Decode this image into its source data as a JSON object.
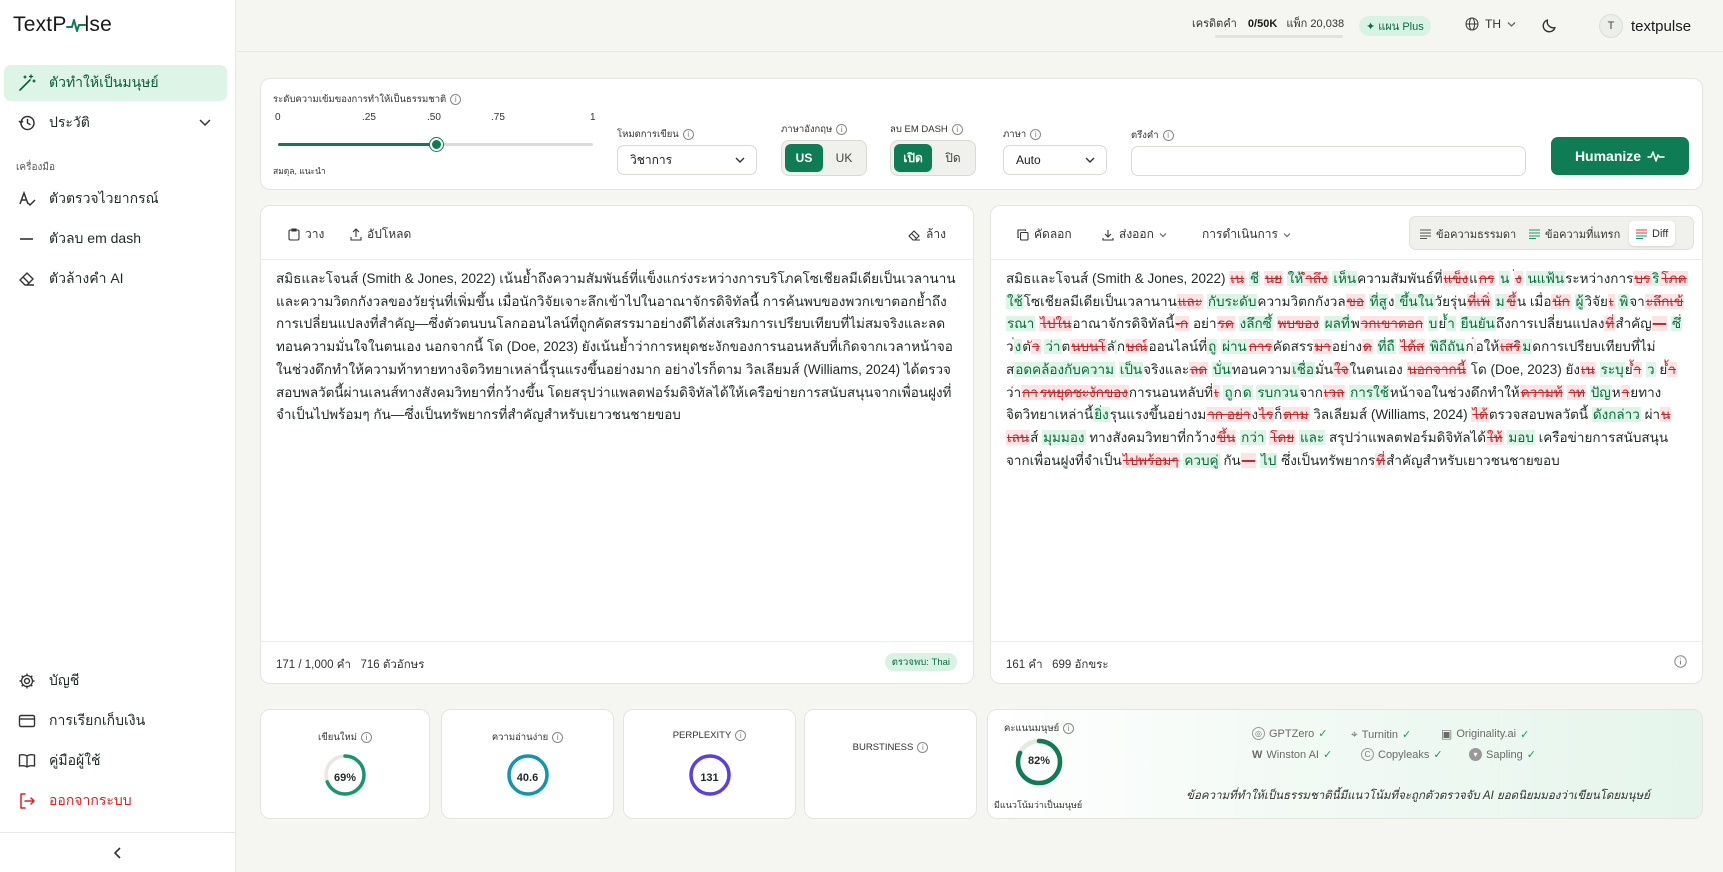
{
  "app": {
    "logo_left": "TextP",
    "logo_right": "lse"
  },
  "sidebar": {
    "items": [
      {
        "label": "ตัวทำให้เป็นมนุษย์",
        "icon": "magic-wand-icon"
      },
      {
        "label": "ประวัติ",
        "icon": "history-icon"
      }
    ],
    "section_label": "เครื่องมือ",
    "tools": [
      {
        "label": "ตัวตรวจไวยากรณ์",
        "icon": "grammar-icon"
      },
      {
        "label": "ตัวลบ em dash",
        "icon": "dash-icon"
      },
      {
        "label": "ตัวล้างคำ AI",
        "icon": "eraser-icon"
      }
    ],
    "bottom": [
      {
        "label": "บัญชี",
        "icon": "gear-icon"
      },
      {
        "label": "การเรียกเก็บเงิน",
        "icon": "credit-card-icon"
      },
      {
        "label": "คู่มือผู้ใช้",
        "icon": "book-icon"
      },
      {
        "label": "ออกจากระบบ",
        "icon": "logout-icon"
      }
    ],
    "collapse_icon": "chevron-left-icon"
  },
  "topbar": {
    "credits_label": "เครดิตคำ",
    "credits_value": "0/50K",
    "pack_label": "แพ็ก",
    "pack_value": "20,038",
    "credits_used_fraction": 0,
    "plan": "แผน Plus",
    "language": "TH",
    "username": "textpulse",
    "avatar_letter": "T"
  },
  "settings": {
    "intensity_label": "ระดับความเข้มของการทำให้เป็นธรรมชาติ",
    "ticks": [
      "0",
      ".25",
      ".50",
      ".75",
      "1"
    ],
    "intensity_value": 0.5,
    "intensity_hint": "สมดุล, แนะนำ",
    "mode_label": "โหมดการเขียน",
    "mode_value": "วิชาการ",
    "english_label": "ภาษาอังกฤษ",
    "english_options": [
      "US",
      "UK"
    ],
    "english_selected": "US",
    "emdash_label": "ลบ EM DASH",
    "emdash_options": [
      "เปิด",
      "ปิด"
    ],
    "emdash_selected": "เปิด",
    "language_label": "ภาษา",
    "language_value": "Auto",
    "keywords_label": "ตรึงคำ",
    "keywords_value": "",
    "humanize_button": "Humanize"
  },
  "input_panel": {
    "paste": "วาง",
    "upload": "อัปโหลด",
    "clear": "ล้าง",
    "text": "สมิธและโจนส์ (Smith & Jones, 2022) เน้นย้ำถึงความสัมพันธ์ที่แข็งแกร่งระหว่างการบริโภคโซเชียลมีเดียเป็นเวลานานและความวิตกกังวลของวัยรุ่นที่เพิ่มขึ้น เมื่อนักวิจัยเจาะลึกเข้าไปในอาณาจักรดิจิทัลนี้ การค้นพบของพวกเขาตอกย้ำถึงการเปลี่ยนแปลงที่สำคัญ—ซึ่งตัวตนบนโลกออนไลน์ที่ถูกคัดสรรมาอย่างดีได้ส่งเสริมการเปรียบเทียบที่ไม่สมจริงและลดทอนความมั่นใจในตนเอง นอกจากนี้ โด (Doe, 2023) ยังเน้นย้ำว่าการหยุดชะงักของการนอนหลับที่เกิดจากเวลาหน้าจอในช่วงดึกทำให้ความท้าทายทางจิตวิทยาเหล่านี้รุนแรงขึ้นอย่างมาก อย่างไรก็ตาม วิลเลียมส์ (Williams, 2024) ได้ตรวจสอบพลวัตนี้ผ่านเลนส์ทางสังคมวิทยาที่กว้างขึ้น โดยสรุปว่าแพลตฟอร์มดิจิทัลได้ให้เครือข่ายการสนับสนุนจากเพื่อนฝูงที่จำเป็นไปพร้อมๆ กัน—ซึ่งเป็นทรัพยากรที่สำคัญสำหรับเยาวชนชายขอบ",
    "word_count": "171 / 1,000 คำ",
    "char_count": "716 ตัวอักษร",
    "detected": "ตรวจพบ: Thai"
  },
  "output_panel": {
    "copy": "คัดลอก",
    "export": "ส่งออก",
    "actions": "การดำเนินการ",
    "view_plain": "ข้อความธรรมดา",
    "view_inserted": "ข้อความที่แทรก",
    "view_diff": "Diff",
    "diff": [
      {
        "t": "n",
        "v": "สมิธและโจนส์ (Smith & Jones, 2022) "
      },
      {
        "t": "d",
        "v": "เน"
      },
      {
        "t": "n",
        "v": " "
      },
      {
        "t": "i",
        "v": "ชี"
      },
      {
        "t": "n",
        "v": " "
      },
      {
        "t": "d",
        "v": "นย"
      },
      {
        "t": "n",
        "v": " "
      },
      {
        "t": "i",
        "v": "ให้"
      },
      {
        "t": "d",
        "v": "ำถึง"
      },
      {
        "t": "n",
        "v": " "
      },
      {
        "t": "i",
        "v": "เห็น"
      },
      {
        "t": "n",
        "v": "ความสัมพันธ์ที่"
      },
      {
        "t": "d",
        "v": "แข็ง"
      },
      {
        "t": "n",
        "v": "แ"
      },
      {
        "t": "d",
        "v": "กร"
      },
      {
        "t": "n",
        "v": " "
      },
      {
        "t": "i",
        "v": "น"
      },
      {
        "t": "n",
        "v": " "
      },
      {
        "t": "d",
        "v": "่ง"
      },
      {
        "t": "n",
        "v": " "
      },
      {
        "t": "i",
        "v": "นแฟ้น"
      },
      {
        "t": "n",
        "v": "ระหว่างการ"
      },
      {
        "t": "d",
        "v": "บร"
      },
      {
        "t": "i",
        "v": "ริ"
      },
      {
        "t": "d",
        "v": "โภค"
      },
      {
        "t": "i",
        "v": "ใช้"
      },
      {
        "t": "n",
        "v": "โซเชียลมีเดียเป็นเวลานาน"
      },
      {
        "t": "d",
        "v": "และ"
      },
      {
        "t": "n",
        "v": " "
      },
      {
        "t": "i",
        "v": "กับระดับ"
      },
      {
        "t": "n",
        "v": "ความวิตกกังวล"
      },
      {
        "t": "d",
        "v": "ขอ"
      },
      {
        "t": "n",
        "v": " "
      },
      {
        "t": "i",
        "v": "ที่สู"
      },
      {
        "t": "n",
        "v": "ง"
      },
      {
        "t": "i",
        "v": " ขึ้นใน"
      },
      {
        "t": "n",
        "v": "วัยรุ่น"
      },
      {
        "t": "d",
        "v": "ที่เพิ่"
      },
      {
        "t": "n",
        "v": " "
      },
      {
        "t": "i",
        "v": "ม"
      },
      {
        "t": "d",
        "v": "ขึ้"
      },
      {
        "t": "n",
        "v": "น เมื่อ"
      },
      {
        "t": "d",
        "v": "นัก"
      },
      {
        "t": "n",
        "v": " "
      },
      {
        "t": "i",
        "v": "ผู้"
      },
      {
        "t": "n",
        "v": "วิจัย"
      },
      {
        "t": "d",
        "v": "เ"
      },
      {
        "t": "n",
        "v": " "
      },
      {
        "t": "i",
        "v": "พิ"
      },
      {
        "t": "n",
        "v": "จา"
      },
      {
        "t": "d",
        "v": "ะลึกเข้"
      },
      {
        "t": "n",
        "v": " "
      },
      {
        "t": "i",
        "v": "รณา"
      },
      {
        "t": "n",
        "v": " "
      },
      {
        "t": "d",
        "v": "ไปใน"
      },
      {
        "t": "n",
        "v": "อาณาจักรดิจิทัลนี้"
      },
      {
        "t": "d",
        "v": "-ก"
      },
      {
        "t": "n",
        "v": " อย่า"
      },
      {
        "t": "d",
        "v": "รค"
      },
      {
        "t": "n",
        "v": " "
      },
      {
        "t": "i",
        "v": "งลึกซึ้"
      },
      {
        "t": "n",
        "v": " "
      },
      {
        "t": "d",
        "v": "พบของ"
      },
      {
        "t": "n",
        "v": " "
      },
      {
        "t": "i",
        "v": "ผลที่"
      },
      {
        "t": "n",
        "v": "พ"
      },
      {
        "t": "d",
        "v": "วกเขาตอก"
      },
      {
        "t": "n",
        "v": " "
      },
      {
        "t": "i",
        "v": "บ"
      },
      {
        "t": "n",
        "v": "ย"
      },
      {
        "t": "i",
        "v": "้ำ"
      },
      {
        "t": "n",
        "v": " "
      },
      {
        "t": "i",
        "v": "ยืนยัน"
      },
      {
        "t": "n",
        "v": "ถึงการเปลี่ยนแปลง"
      },
      {
        "t": "d",
        "v": "ที่"
      },
      {
        "t": "n",
        "v": "สำคัญ"
      },
      {
        "t": "d",
        "v": "—"
      },
      {
        "t": "n",
        "v": " "
      },
      {
        "t": "i",
        "v": "ซึ่"
      },
      {
        "t": "n",
        "v": " ว"
      },
      {
        "t": "i",
        "v": "่ง"
      },
      {
        "t": "n",
        "v": "ต"
      },
      {
        "t": "d",
        "v": "ัว"
      },
      {
        "t": "n",
        "v": " "
      },
      {
        "t": "i",
        "v": "ว่า"
      },
      {
        "t": "n",
        "v": "ต"
      },
      {
        "t": "d",
        "v": "นบนโ"
      },
      {
        "t": "n",
        "v": "ล"
      },
      {
        "t": "i",
        "v": "ั"
      },
      {
        "t": "n",
        "v": "ก"
      },
      {
        "t": "d",
        "v": "ษณ์"
      },
      {
        "t": "n",
        "v": "ออนไลน์ที่"
      },
      {
        "t": "i",
        "v": "ถู"
      },
      {
        "t": "n",
        "v": " "
      },
      {
        "t": "i",
        "v": "ผ่าน"
      },
      {
        "t": "d",
        "v": "การ"
      },
      {
        "t": "n",
        "v": "คัดสรร"
      },
      {
        "t": "d",
        "v": "มา"
      },
      {
        "t": "n",
        "v": "อย่าง"
      },
      {
        "t": "d",
        "v": "ด"
      },
      {
        "t": "n",
        "v": " "
      },
      {
        "t": "i",
        "v": "ที่ถื"
      },
      {
        "t": "n",
        "v": " "
      },
      {
        "t": "d",
        "v": "ได้ส"
      },
      {
        "t": "n",
        "v": " "
      },
      {
        "t": "i",
        "v": "พิถีถัน"
      },
      {
        "t": "n",
        "v": "ก"
      },
      {
        "t": "d",
        "v": "่"
      },
      {
        "t": "n",
        "v": "อให้"
      },
      {
        "t": "d",
        "v": "เสร"
      },
      {
        "t": "n",
        "v": "ิ"
      },
      {
        "t": "i",
        "v": "ม"
      },
      {
        "t": "n",
        "v": "ด"
      },
      {
        "t": "n",
        "v": "การเปรียบเทียบที่"
      },
      {
        "t": "n",
        "v": "ไม่ส"
      },
      {
        "t": "i",
        "v": "อดคล้องกับความ"
      },
      {
        "t": "n",
        "v": " "
      },
      {
        "t": "i",
        "v": "เป็น"
      },
      {
        "t": "n",
        "v": "จริงและ"
      },
      {
        "t": "d",
        "v": "ลด"
      },
      {
        "t": "n",
        "v": " "
      },
      {
        "t": "i",
        "v": "บั่น"
      },
      {
        "t": "n",
        "v": "ทอนความ"
      },
      {
        "t": "i",
        "v": "เชื่อ"
      },
      {
        "t": "n",
        "v": "มั่น"
      },
      {
        "t": "d",
        "v": "ใจ"
      },
      {
        "t": "n",
        "v": "ในตนเอง "
      },
      {
        "t": "d",
        "v": "นอกจากนี้"
      },
      {
        "t": "n",
        "v": " โด (Doe, 2023) ยัง"
      },
      {
        "t": "d",
        "v": "เน"
      },
      {
        "t": "n",
        "v": " "
      },
      {
        "t": "i",
        "v": "ระบุ"
      },
      {
        "t": "n",
        "v": "ย"
      },
      {
        "t": "d",
        "v": "้ำ"
      },
      {
        "t": "n",
        "v": " "
      },
      {
        "t": "i",
        "v": "ว"
      },
      {
        "t": "n",
        "v": " "
      },
      {
        "t": "n",
        "v": "ย"
      },
      {
        "t": "d",
        "v": "้ำ"
      },
      {
        "t": "n",
        "v": "ว่า"
      },
      {
        "t": "d",
        "v": "กา"
      },
      {
        "t": "d",
        "v": "รหยุดชะงักของ"
      },
      {
        "t": "n",
        "v": "การนอนหลับที่"
      },
      {
        "t": "d",
        "v": "เ"
      },
      {
        "t": "n",
        "v": " "
      },
      {
        "t": "i",
        "v": "ถู"
      },
      {
        "t": "n",
        "v": "ก"
      },
      {
        "t": "i",
        "v": "ด"
      },
      {
        "t": "n",
        "v": " "
      },
      {
        "t": "i",
        "v": "รบกวน"
      },
      {
        "t": "n",
        "v": "จาก"
      },
      {
        "t": "d",
        "v": "เวล"
      },
      {
        "t": "n",
        "v": " "
      },
      {
        "t": "i",
        "v": "การใช้"
      },
      {
        "t": "n",
        "v": "หน้าจอในช่วงดึกทำให้"
      },
      {
        "t": "d",
        "v": "ความท้"
      },
      {
        "t": "n",
        "v": " "
      },
      {
        "t": "d",
        "v": "าท"
      },
      {
        "t": "n",
        "v": " "
      },
      {
        "t": "i",
        "v": "ปัญ"
      },
      {
        "t": "n",
        "v": "ห"
      },
      {
        "t": "d",
        "v": "า"
      },
      {
        "t": "n",
        "v": "ย"
      },
      {
        "t": "n",
        "v": "ทาง"
      },
      {
        "t": "n",
        "v": "จิตวิทยาเหล่านี้"
      },
      {
        "t": "i",
        "v": "ยิ่ง"
      },
      {
        "t": "n",
        "v": "รุนแรงขึ้นอย่างม"
      },
      {
        "t": "d",
        "v": "าก อย่า"
      },
      {
        "t": "n",
        "v": "ง"
      },
      {
        "t": "d",
        "v": "ไร"
      },
      {
        "t": "n",
        "v": "ก็"
      },
      {
        "t": "d",
        "v": "ตาม"
      },
      {
        "t": "n",
        "v": " วิลเลียมส์ (Williams, 2024) "
      },
      {
        "t": "d",
        "v": "ได้"
      },
      {
        "t": "n",
        "v": "ตรวจสอบพลวัตนี้ "
      },
      {
        "t": "i",
        "v": "ดังกล่าว"
      },
      {
        "t": "n",
        "v": " ผ่า"
      },
      {
        "t": "d",
        "v": "น"
      },
      {
        "t": "n",
        "v": " "
      },
      {
        "t": "d",
        "v": "เลน"
      },
      {
        "t": "n",
        "v": "ส์ "
      },
      {
        "t": "i",
        "v": "มุมมอง"
      },
      {
        "t": "n",
        "v": " ทางสังคมวิทยาที่กว้าง"
      },
      {
        "t": "d",
        "v": "ขึ้น"
      },
      {
        "t": "n",
        "v": " "
      },
      {
        "t": "i",
        "v": "กว่า"
      },
      {
        "t": "n",
        "v": " "
      },
      {
        "t": "d",
        "v": "โดย"
      },
      {
        "t": "n",
        "v": " "
      },
      {
        "t": "i",
        "v": "และ"
      },
      {
        "t": "n",
        "v": " สรุปว่าแพลตฟอร์มดิจิทัลได้"
      },
      {
        "t": "d",
        "v": "ให้"
      },
      {
        "t": "n",
        "v": " "
      },
      {
        "t": "i",
        "v": "มอบ"
      },
      {
        "t": "n",
        "v": " เครือข่ายการสนับสนุนจาก"
      },
      {
        "t": "n",
        "v": "เพื่อนฝูงที่จำเป็น"
      },
      {
        "t": "d",
        "v": "ไปพร้อมๆ"
      },
      {
        "t": "n",
        "v": " "
      },
      {
        "t": "i",
        "v": "ควบคู่"
      },
      {
        "t": "n",
        "v": " กัน"
      },
      {
        "t": "d",
        "v": "—"
      },
      {
        "t": "n",
        "v": " "
      },
      {
        "t": "i",
        "v": "ไป"
      },
      {
        "t": "n",
        "v": " ซึ่งเป็นทรัพยากร"
      },
      {
        "t": "d",
        "v": "ที่"
      },
      {
        "t": "n",
        "v": "สำคัญสำหรับเยาวชนชายขอบ"
      }
    ],
    "word_count": "161 คำ",
    "char_count": "699 อักขระ"
  },
  "metrics": [
    {
      "label": "เขียนใหม่",
      "value": "69%",
      "fraction": 0.69,
      "color": "#16966a"
    },
    {
      "label": "ความอ่านง่าย",
      "value": "40.6",
      "fraction": 1.0,
      "color": "#1196b0"
    },
    {
      "label": "PERPLEXITY",
      "value": "131",
      "fraction": 1.0,
      "color": "#5b3fe0"
    },
    {
      "label": "BURSTINESS",
      "value": "",
      "fraction": 0,
      "color": "#cccccc"
    }
  ],
  "score": {
    "label": "คะแนนมนุษย์",
    "value": "82%",
    "fraction": 0.82,
    "color": "#0e7c54",
    "sublabel": "มีแนวโน้มว่าเป็นมนุษย์",
    "detectors": [
      "GPTZero",
      "Turnitin",
      "Originality.ai",
      "Winston AI",
      "Copyleaks",
      "Sapling"
    ],
    "caption": "ข้อความที่ทำให้เป็นธรรมชาตินี้มีแนวโน้มที่จะถูกตัวตรวจจับ AI ยอดนิยมมองว่าเขียนโดยมนุษย์"
  }
}
